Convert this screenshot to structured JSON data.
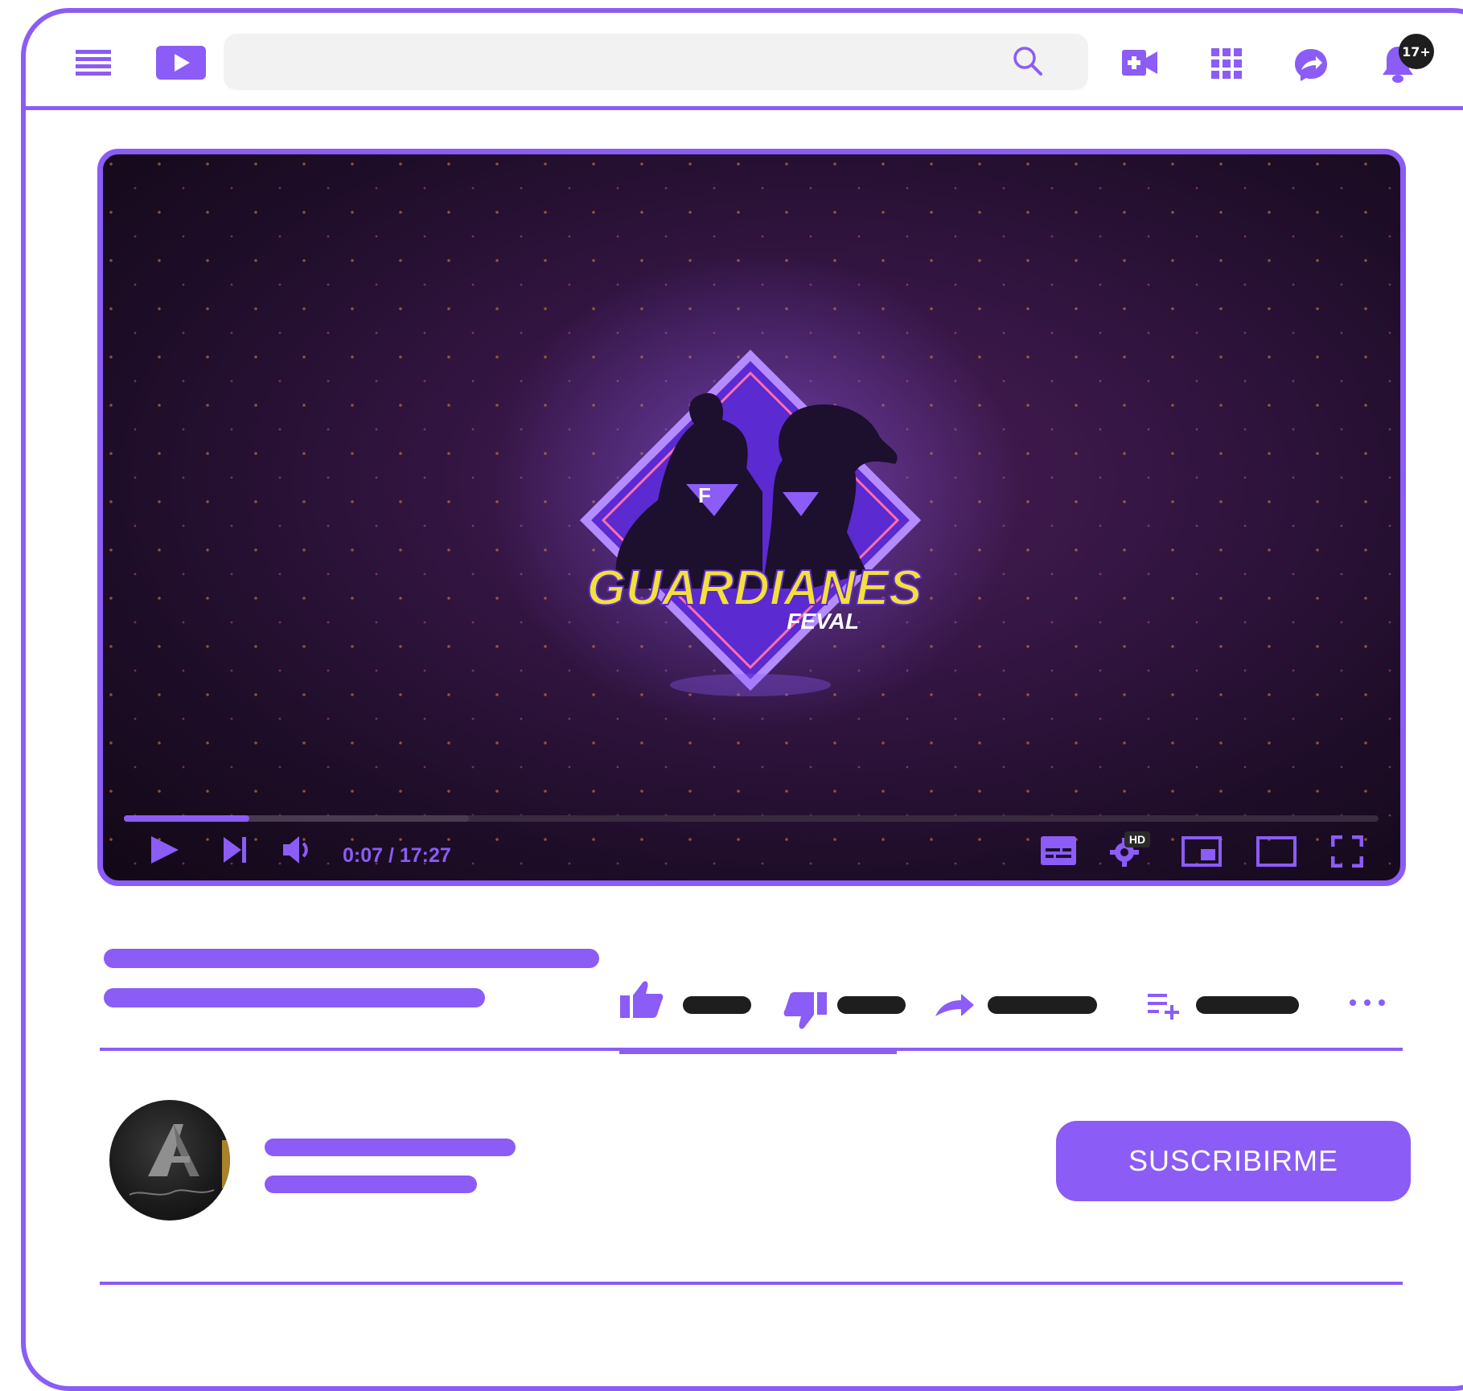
{
  "header": {
    "icons": [
      "menu-icon",
      "play-logo-icon",
      "search-icon",
      "add-video-icon",
      "apps-grid-icon",
      "messenger-icon",
      "bell-icon"
    ],
    "notification_badge": "17+"
  },
  "player": {
    "time": "0:07 / 17:27",
    "progress_fraction": 0.1,
    "buffered_fraction": 0.275,
    "video_title_text": "GUARDIANES",
    "video_subtitle_text": "FEVAL",
    "hd_label": "HD"
  },
  "channel": {
    "subscribe_label": "SUSCRIBIRME"
  },
  "colors": {
    "accent": "#8b5cf6",
    "dark": "#1e1e1e",
    "search_bg": "#f2f2f2"
  }
}
